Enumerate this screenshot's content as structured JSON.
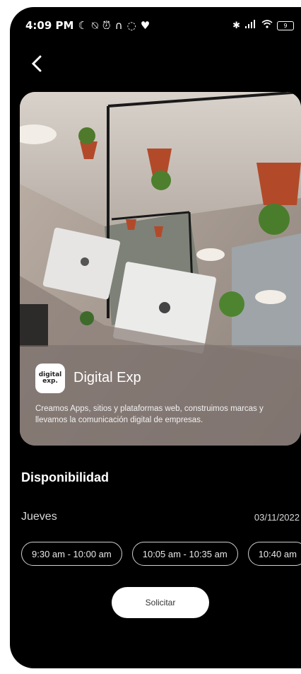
{
  "status": {
    "time": "4:09 PM",
    "left_icons": [
      "moon-icon",
      "alarm-off-icon",
      "alarm-icon",
      "headphones-icon",
      "whatsapp-icon",
      "heart-icon"
    ],
    "battery": "9"
  },
  "company": {
    "logo_line1": "digital",
    "logo_line2": "exp.",
    "name": "Digital Exp",
    "description": "Creamos Apps, sitios y plataformas web, construimos marcas y llevamos la comunicación digital de empresas."
  },
  "availability": {
    "title": "Disponibilidad",
    "day": "Jueves",
    "date": "03/11/2022",
    "slots": [
      "9:30 am - 10:00 am",
      "10:05 am - 10:35 am",
      "10:40 am"
    ]
  },
  "actions": {
    "request_label": "Solicitar"
  }
}
